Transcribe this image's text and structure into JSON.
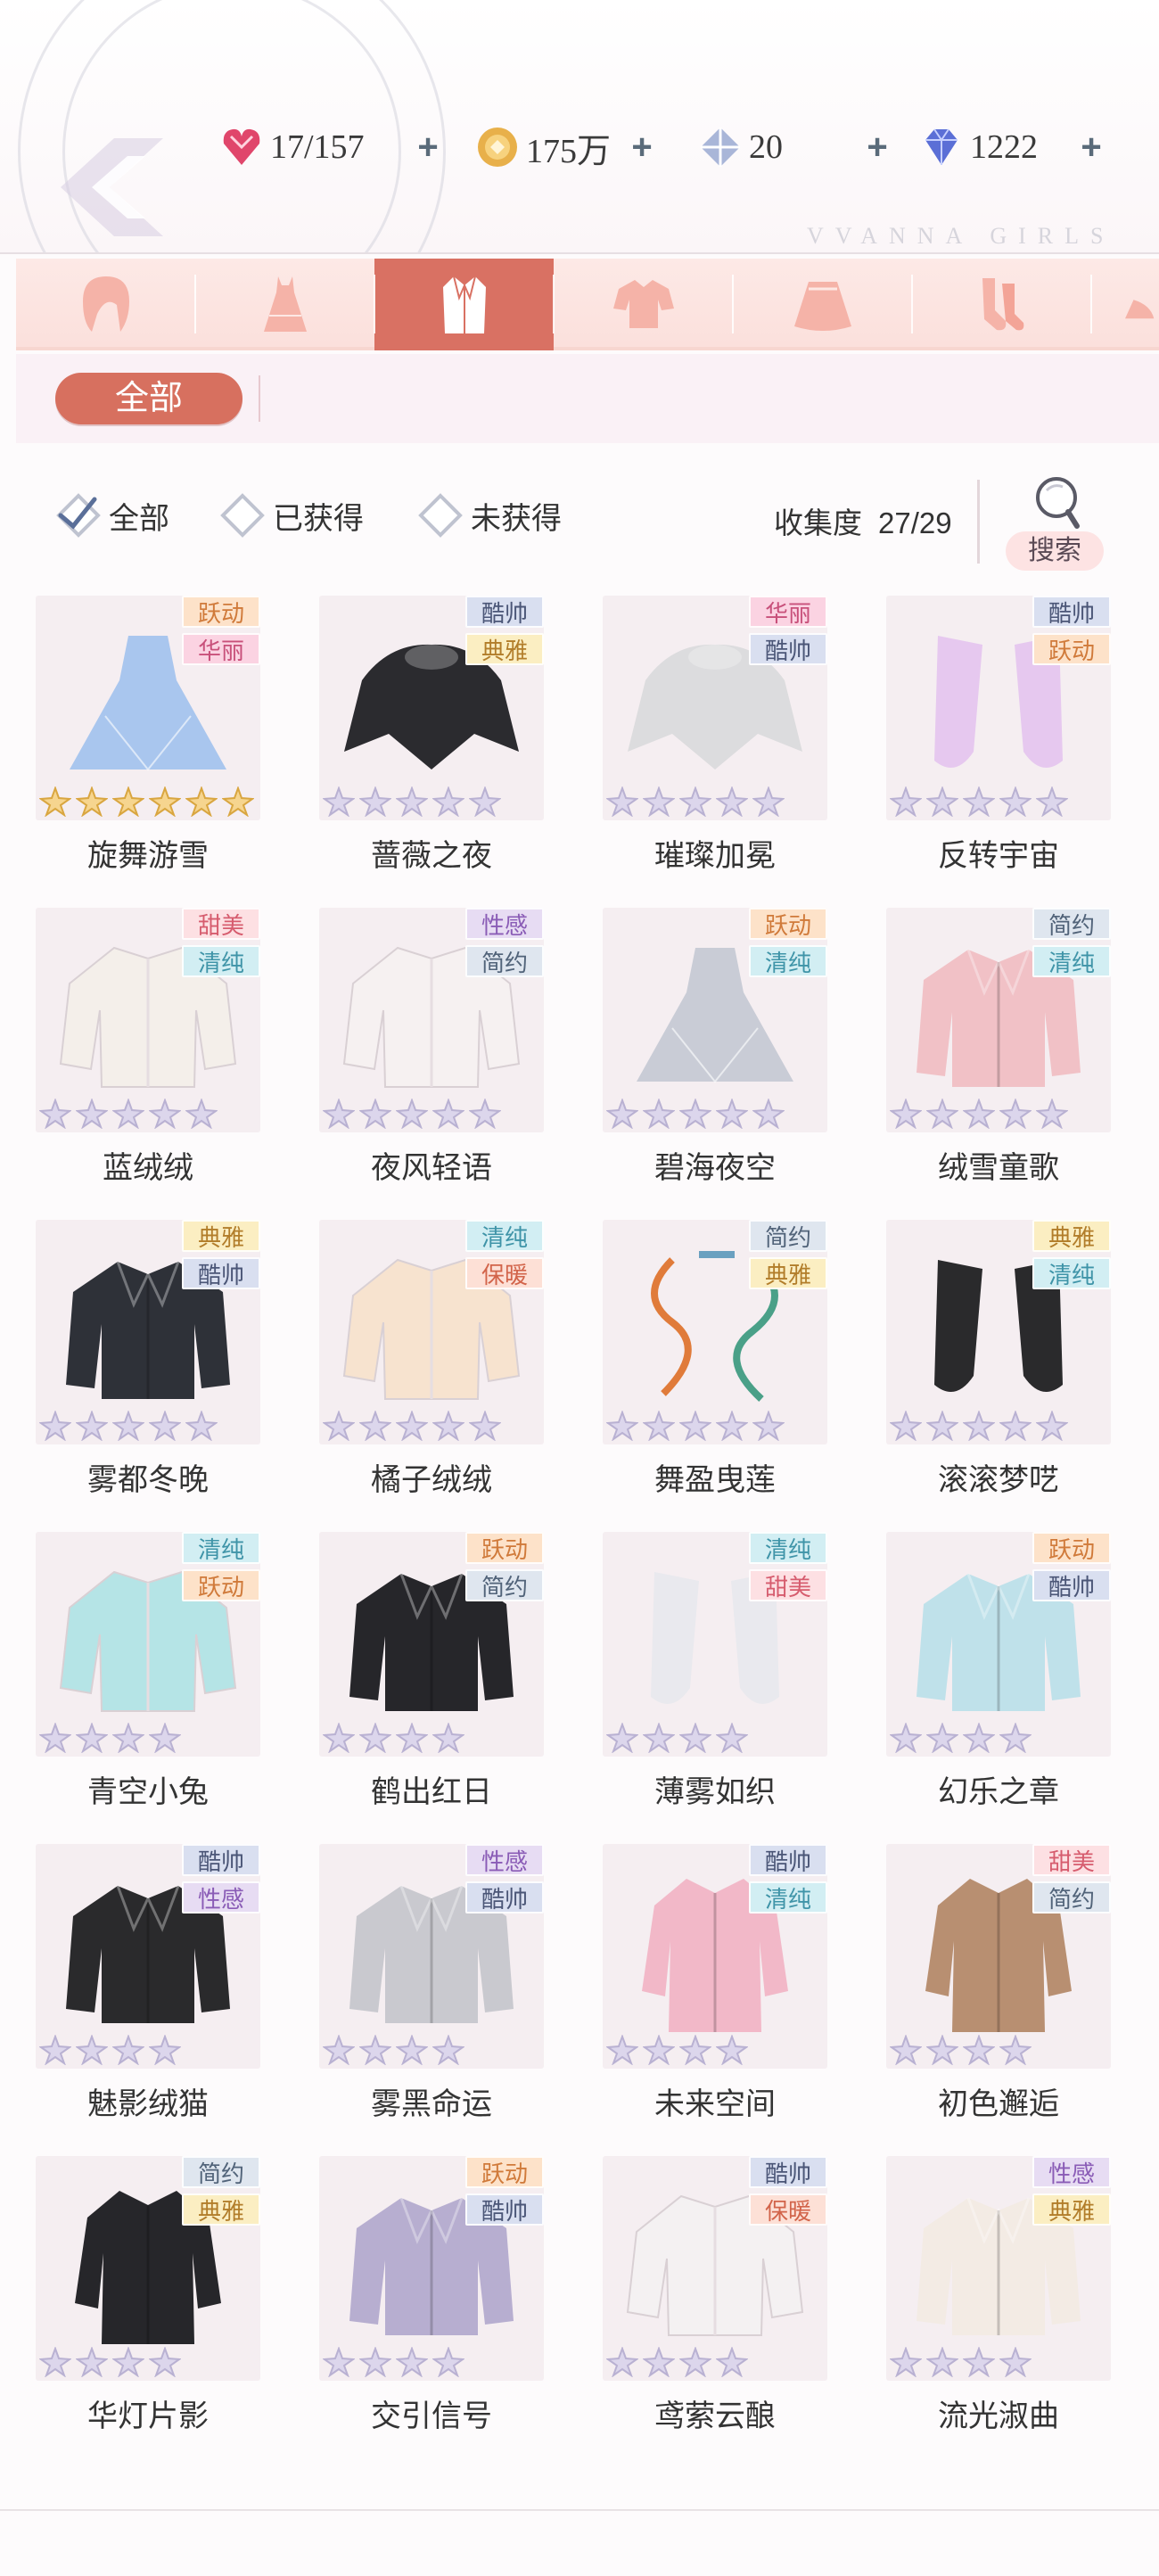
{
  "currencies": [
    {
      "name": "stamina",
      "icon": "heart-gem-icon",
      "value": "17/157",
      "color": "#e0466b"
    },
    {
      "name": "coins",
      "icon": "gold-coin-icon",
      "value": "175万",
      "color": "#e8b04a"
    },
    {
      "name": "crystal",
      "icon": "crystal-icon",
      "value": "20",
      "color": "#a9b6d8"
    },
    {
      "name": "diamond",
      "icon": "diamond-icon",
      "value": "1222",
      "color": "#5b6fd6"
    }
  ],
  "watermark": "VVANNA GIRLS",
  "tabs": [
    {
      "name": "hair",
      "icon": "hair-icon",
      "active": false
    },
    {
      "name": "dress",
      "icon": "dress-icon",
      "active": false
    },
    {
      "name": "coat",
      "icon": "coat-icon",
      "active": true
    },
    {
      "name": "top",
      "icon": "top-icon",
      "active": false
    },
    {
      "name": "skirt",
      "icon": "skirt-icon",
      "active": false
    },
    {
      "name": "socks",
      "icon": "socks-icon",
      "active": false
    },
    {
      "name": "shoes",
      "icon": "shoes-icon",
      "active": false
    }
  ],
  "subfilter": {
    "selected": "全部"
  },
  "filters": [
    {
      "label": "全部",
      "checked": true
    },
    {
      "label": "已获得",
      "checked": false
    },
    {
      "label": "未获得",
      "checked": false
    }
  ],
  "collection": {
    "label": "收集度",
    "value": "27/29"
  },
  "search_label": "搜索",
  "tag_colors": {
    "跃动": {
      "bg": "#fde2c9",
      "fg": "#d07a3a"
    },
    "华丽": {
      "bg": "#fbd3e2",
      "fg": "#c8507a"
    },
    "酷帅": {
      "bg": "#d9dff0",
      "fg": "#4b5677"
    },
    "典雅": {
      "bg": "#fbeec2",
      "fg": "#b27d2a"
    },
    "甜美": {
      "bg": "#fde0e3",
      "fg": "#d65c6e"
    },
    "清纯": {
      "bg": "#d2eef3",
      "fg": "#3f94a8"
    },
    "性感": {
      "bg": "#e7dcf3",
      "fg": "#8a5cb6"
    },
    "简约": {
      "bg": "#dfe6ef",
      "fg": "#516379"
    },
    "保暖": {
      "bg": "#fde0d6",
      "fg": "#d2644a"
    }
  },
  "items": [
    {
      "name": "旋舞游雪",
      "tags": [
        "跃动",
        "华丽"
      ],
      "stars": 6,
      "gold": true,
      "art": "gown-icon",
      "color": "#a9c6ee"
    },
    {
      "name": "蔷薇之夜",
      "tags": [
        "酷帅",
        "典雅"
      ],
      "stars": 5,
      "gold": false,
      "art": "cape-icon",
      "color": "#2b2b2f"
    },
    {
      "name": "璀璨加冕",
      "tags": [
        "华丽",
        "酷帅"
      ],
      "stars": 5,
      "gold": false,
      "art": "cape-icon",
      "color": "#dcdcde"
    },
    {
      "name": "反转宇宙",
      "tags": [
        "酷帅",
        "跃动"
      ],
      "stars": 5,
      "gold": false,
      "art": "sleeves-icon",
      "color": "#e6c8ef"
    },
    {
      "name": "蓝绒绒",
      "tags": [
        "甜美",
        "清纯"
      ],
      "stars": 5,
      "gold": false,
      "art": "cardigan-icon",
      "color": "#f4efea"
    },
    {
      "name": "夜风轻语",
      "tags": [
        "性感",
        "简约"
      ],
      "stars": 5,
      "gold": false,
      "art": "cardigan-icon",
      "color": "#f6f1f1"
    },
    {
      "name": "碧海夜空",
      "tags": [
        "跃动",
        "清纯"
      ],
      "stars": 5,
      "gold": false,
      "art": "gown-icon",
      "color": "#c9ccd6"
    },
    {
      "name": "绒雪童歌",
      "tags": [
        "简约",
        "清纯"
      ],
      "stars": 5,
      "gold": false,
      "art": "jacket-icon",
      "color": "#f1c1c6"
    },
    {
      "name": "雾都冬晚",
      "tags": [
        "典雅",
        "酷帅"
      ],
      "stars": 5,
      "gold": false,
      "art": "jacket-icon",
      "color": "#2e3138"
    },
    {
      "name": "橘子绒绒",
      "tags": [
        "清纯",
        "保暖"
      ],
      "stars": 5,
      "gold": false,
      "art": "cardigan-icon",
      "color": "#f7e3cf"
    },
    {
      "name": "舞盈曳莲",
      "tags": [
        "简约",
        "典雅"
      ],
      "stars": 5,
      "gold": false,
      "art": "ribbon-icon",
      "color": "#e07b3a"
    },
    {
      "name": "滚滚梦呓",
      "tags": [
        "典雅",
        "清纯"
      ],
      "stars": 5,
      "gold": false,
      "art": "sleeves-icon",
      "color": "#2a2a2c"
    },
    {
      "name": "青空小兔",
      "tags": [
        "清纯",
        "跃动"
      ],
      "stars": 4,
      "gold": false,
      "art": "cardigan-icon",
      "color": "#b5e4e6"
    },
    {
      "name": "鹤出红日",
      "tags": [
        "跃动",
        "简约"
      ],
      "stars": 4,
      "gold": false,
      "art": "jacket-icon",
      "color": "#26262a"
    },
    {
      "name": "薄雾如织",
      "tags": [
        "清纯",
        "甜美"
      ],
      "stars": 4,
      "gold": false,
      "art": "sleeves-icon",
      "color": "#e9e9ee"
    },
    {
      "name": "幻乐之章",
      "tags": [
        "跃动",
        "酷帅"
      ],
      "stars": 4,
      "gold": false,
      "art": "jacket-icon",
      "color": "#bfe1ea"
    },
    {
      "name": "魅影绒猫",
      "tags": [
        "酷帅",
        "性感"
      ],
      "stars": 4,
      "gold": false,
      "art": "jacket-icon",
      "color": "#2a2a2c"
    },
    {
      "name": "雾黑命运",
      "tags": [
        "性感",
        "酷帅"
      ],
      "stars": 4,
      "gold": false,
      "art": "jacket-icon",
      "color": "#c9c9cf"
    },
    {
      "name": "未来空间",
      "tags": [
        "酷帅",
        "清纯"
      ],
      "stars": 4,
      "gold": false,
      "art": "coat-long-icon",
      "color": "#f2b8c8"
    },
    {
      "name": "初色邂逅",
      "tags": [
        "甜美",
        "简约"
      ],
      "stars": 4,
      "gold": false,
      "art": "coat-long-icon",
      "color": "#b88f71"
    },
    {
      "name": "华灯片影",
      "tags": [
        "简约",
        "典雅"
      ],
      "stars": 4,
      "gold": false,
      "art": "coat-long-icon",
      "color": "#26262a"
    },
    {
      "name": "交引信号",
      "tags": [
        "跃动",
        "酷帅"
      ],
      "stars": 4,
      "gold": false,
      "art": "jacket-icon",
      "color": "#b7aed0"
    },
    {
      "name": "鸢萦云酿",
      "tags": [
        "酷帅",
        "保暖"
      ],
      "stars": 4,
      "gold": false,
      "art": "cardigan-icon",
      "color": "#f4f1f2"
    },
    {
      "name": "流光淑曲",
      "tags": [
        "性感",
        "典雅"
      ],
      "stars": 4,
      "gold": false,
      "art": "jacket-icon",
      "color": "#f3ebe4"
    }
  ]
}
